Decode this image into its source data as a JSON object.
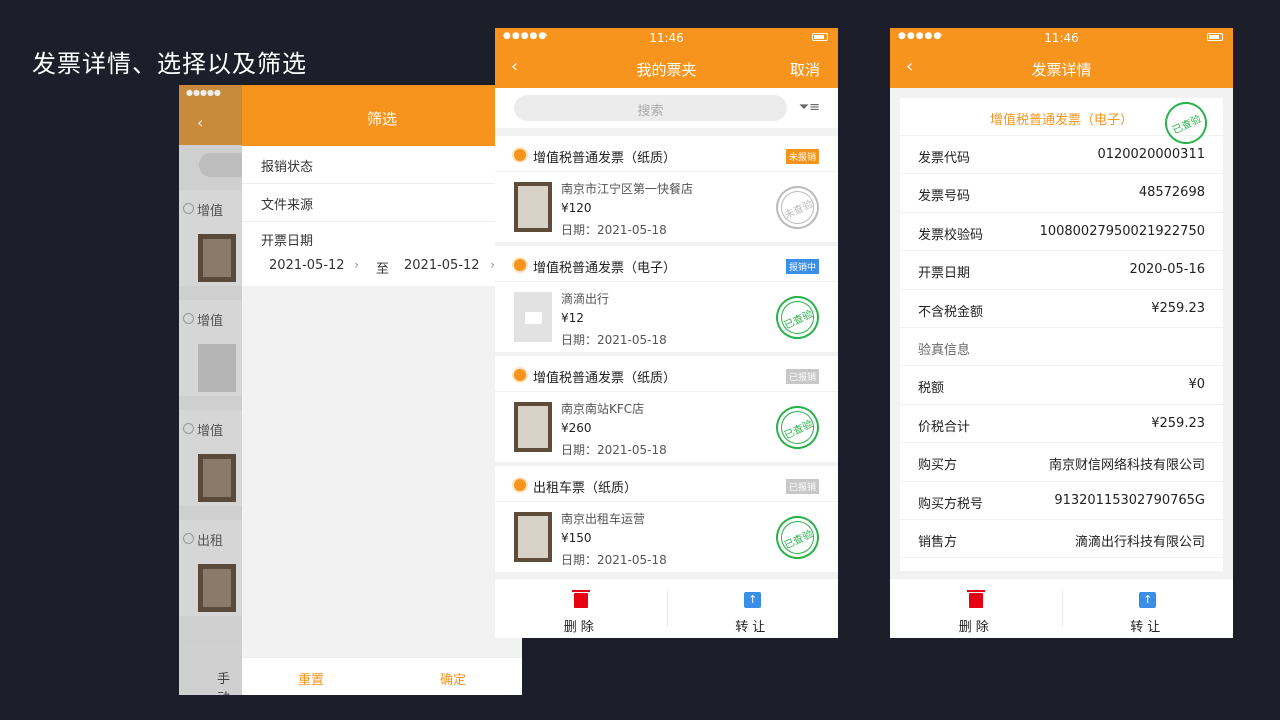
{
  "page_title": "发票详情、选择以及筛选",
  "status": {
    "time": "11:46"
  },
  "filter_screen": {
    "under_rows": [
      {
        "label": "增值"
      },
      {
        "label": "增值"
      },
      {
        "label": "增值"
      },
      {
        "label": "出租"
      }
    ],
    "under_footer": "手动",
    "title": "筛选",
    "fields": [
      "报销状态",
      "文件来源"
    ],
    "date_label": "开票日期",
    "date_from": "2021-05-12",
    "date_to_sep": "至",
    "date_to": "2021-05-12",
    "reset_label": "重置",
    "confirm_label": "确定"
  },
  "list_screen": {
    "title": "我的票夹",
    "cancel_label": "取消",
    "search_placeholder": "搜索",
    "items": [
      {
        "title": "增值税普通发票（纸质）",
        "badge": "未报销",
        "badge_color": "#f7941d",
        "name": "南京市江宁区第一快餐店",
        "price": "¥120",
        "date": "日期：2021-05-18",
        "stamp": "未查验",
        "stamp_gray": true,
        "thumb": "photo"
      },
      {
        "title": "增值税普通发票（电子）",
        "badge": "报销中",
        "badge_color": "#3a8ee6",
        "name": "滴滴出行",
        "price": "¥12",
        "date": "日期：2021-05-18",
        "stamp": "已查验",
        "stamp_gray": false,
        "thumb": "folder"
      },
      {
        "title": "增值税普通发票（纸质）",
        "badge": "已报销",
        "badge_color": "#c8c8c8",
        "name": "南京南站KFC店",
        "price": "¥260",
        "date": "日期：2021-05-18",
        "stamp": "已查验",
        "stamp_gray": false,
        "thumb": "photo"
      },
      {
        "title": "出租车票（纸质）",
        "badge": "已报销",
        "badge_color": "#c8c8c8",
        "name": "南京出租车运营",
        "price": "¥150",
        "date": "日期：2021-05-18",
        "stamp": "已查验",
        "stamp_gray": false,
        "thumb": "photo"
      }
    ],
    "delete_label": "删除",
    "transfer_label": "转让"
  },
  "detail_screen": {
    "title": "发票详情",
    "invoice_type": "增值税普通发票（电子）",
    "stamp": "已查验",
    "rows": [
      {
        "k": "发票代码",
        "v": "0120020000311"
      },
      {
        "k": "发票号码",
        "v": "48572698"
      },
      {
        "k": "发票校验码",
        "v": "10080027950021922750"
      },
      {
        "k": "开票日期",
        "v": "2020-05-16"
      },
      {
        "k": "不含税金额",
        "v": "¥259.23"
      },
      {
        "k": "验真信息",
        "v": "",
        "muted": true
      },
      {
        "k": "税额",
        "v": "¥0"
      },
      {
        "k": "价税合计",
        "v": "¥259.23"
      },
      {
        "k": "购买方",
        "v": "南京财信网络科技有限公司"
      },
      {
        "k": "购买方税号",
        "v": "91320115302790765G"
      },
      {
        "k": "销售方",
        "v": "滴滴出行科技有限公司"
      }
    ],
    "delete_label": "删除",
    "transfer_label": "转让"
  }
}
